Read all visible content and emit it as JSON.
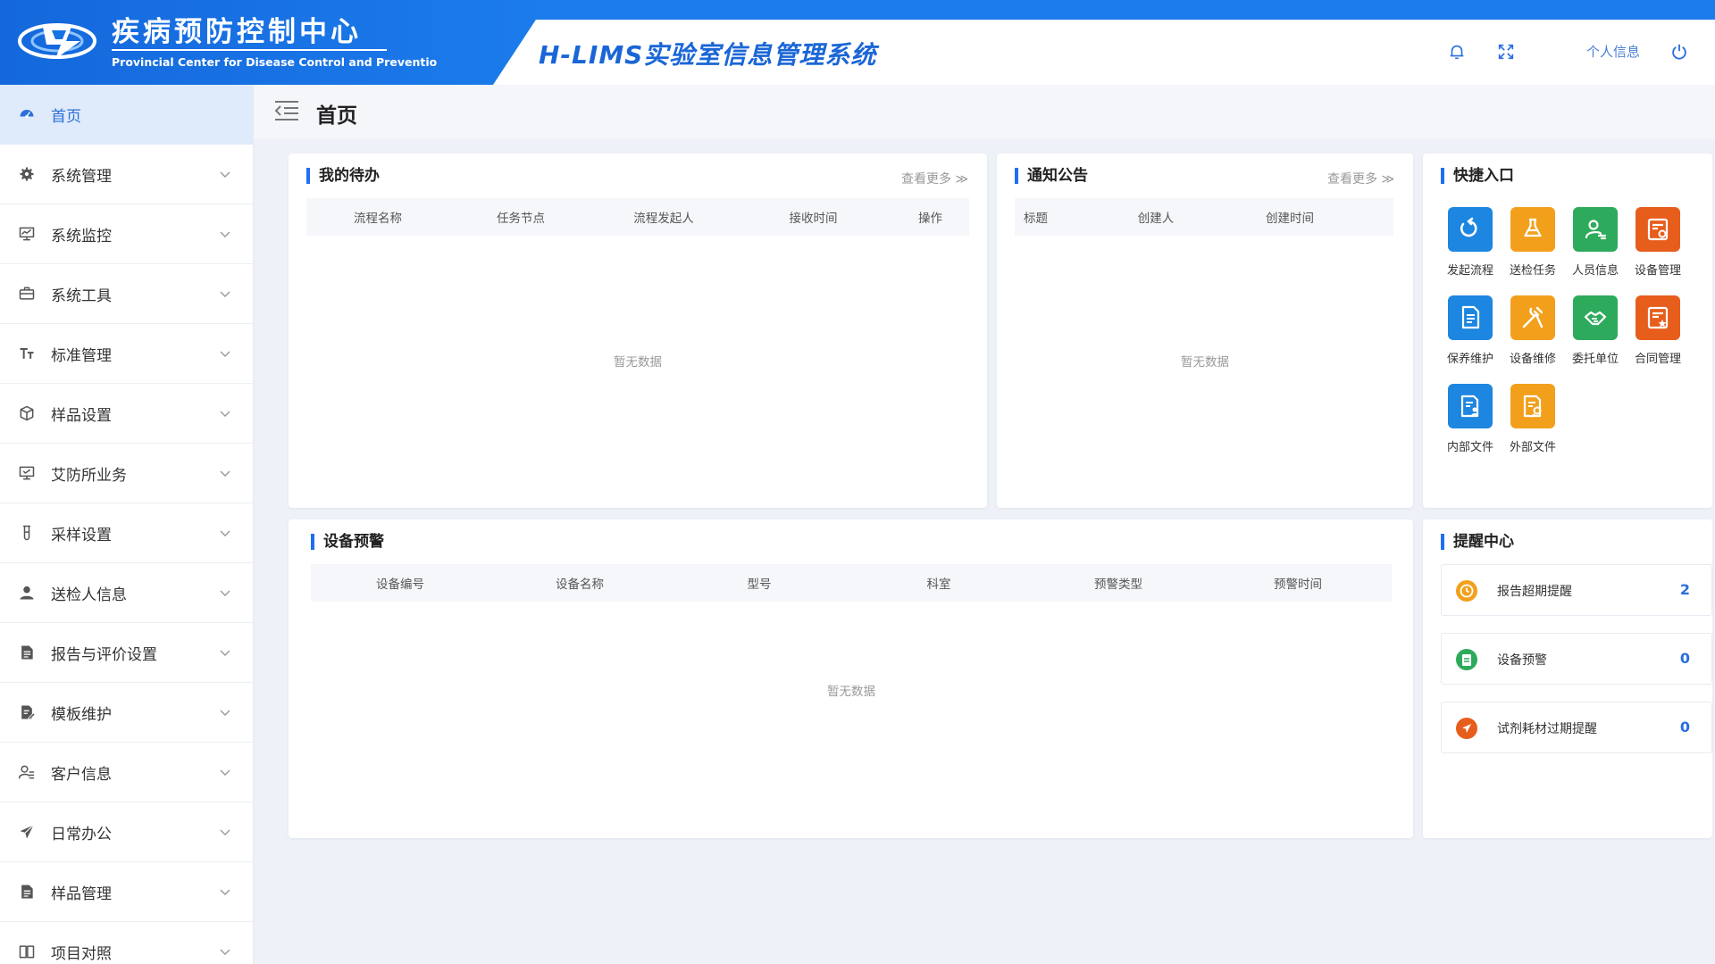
{
  "header": {
    "org_name_cn": "疾病预防控制中心",
    "org_name_en": "Provincial Center for Disease Control and Preventio",
    "system_title": "H-LIMS实验室信息管理系统",
    "icons": [
      "bell-icon",
      "fullscreen-icon",
      "power-icon"
    ],
    "profile_link": "个人信息"
  },
  "sidebar": {
    "items": [
      {
        "label": "首页",
        "icon": "dashboard-icon",
        "active": true
      },
      {
        "label": "系统管理",
        "icon": "gear-icon"
      },
      {
        "label": "系统监控",
        "icon": "monitor-icon"
      },
      {
        "label": "系统工具",
        "icon": "toolbox-icon"
      },
      {
        "label": "标准管理",
        "icon": "text-size-icon"
      },
      {
        "label": "样品设置",
        "icon": "box-icon"
      },
      {
        "label": "艾防所业务",
        "icon": "display-icon"
      },
      {
        "label": "采样设置",
        "icon": "tube-icon"
      },
      {
        "label": "送检人信息",
        "icon": "user-icon"
      },
      {
        "label": "报告与评价设置",
        "icon": "document-icon"
      },
      {
        "label": "模板维护",
        "icon": "edit-doc-icon"
      },
      {
        "label": "客户信息",
        "icon": "person-list-icon"
      },
      {
        "label": "日常办公",
        "icon": "send-icon"
      },
      {
        "label": "样品管理",
        "icon": "document-icon"
      },
      {
        "label": "项目对照",
        "icon": "book-icon"
      }
    ]
  },
  "page": {
    "title": "首页"
  },
  "todo": {
    "title": "我的待办",
    "more": "查看更多",
    "columns": [
      "流程名称",
      "任务节点",
      "流程发起人",
      "接收时间",
      "操作"
    ],
    "empty": "暂无数据"
  },
  "notice": {
    "title": "通知公告",
    "more": "查看更多",
    "columns": [
      "标题",
      "创建人",
      "创建时间"
    ],
    "empty": "暂无数据"
  },
  "quick": {
    "title": "快捷入口",
    "items": [
      {
        "label": "发起流程",
        "color": "#1d86e0",
        "icon": "refresh-icon"
      },
      {
        "label": "送检任务",
        "color": "#f2a01c",
        "icon": "flask-icon"
      },
      {
        "label": "人员信息",
        "color": "#2eaa5c",
        "icon": "person-card-icon"
      },
      {
        "label": "设备管理",
        "color": "#e75d1c",
        "icon": "device-settings-icon"
      },
      {
        "label": "保养维护",
        "color": "#1d86e0",
        "icon": "maintenance-doc-icon"
      },
      {
        "label": "设备维修",
        "color": "#f2a01c",
        "icon": "tools-icon"
      },
      {
        "label": "委托单位",
        "color": "#2eaa5c",
        "icon": "handshake-icon"
      },
      {
        "label": "合同管理",
        "color": "#e75d1c",
        "icon": "contract-icon"
      },
      {
        "label": "内部文件",
        "color": "#1d86e0",
        "icon": "internal-doc-icon"
      },
      {
        "label": "外部文件",
        "color": "#f2a01c",
        "icon": "external-doc-icon"
      }
    ]
  },
  "warning": {
    "title": "设备预警",
    "columns": [
      "设备编号",
      "设备名称",
      "型号",
      "科室",
      "预警类型",
      "预警时间"
    ],
    "empty": "暂无数据"
  },
  "reminder": {
    "title": "提醒中心",
    "items": [
      {
        "label": "报告超期提醒",
        "count": "2",
        "color": "#f2a01c",
        "icon": "clock-icon"
      },
      {
        "label": "设备预警",
        "count": "0",
        "color": "#2eaa5c",
        "icon": "clipboard-icon"
      },
      {
        "label": "试剂耗材过期提醒",
        "count": "0",
        "color": "#e75d1c",
        "icon": "send-icon"
      }
    ]
  }
}
